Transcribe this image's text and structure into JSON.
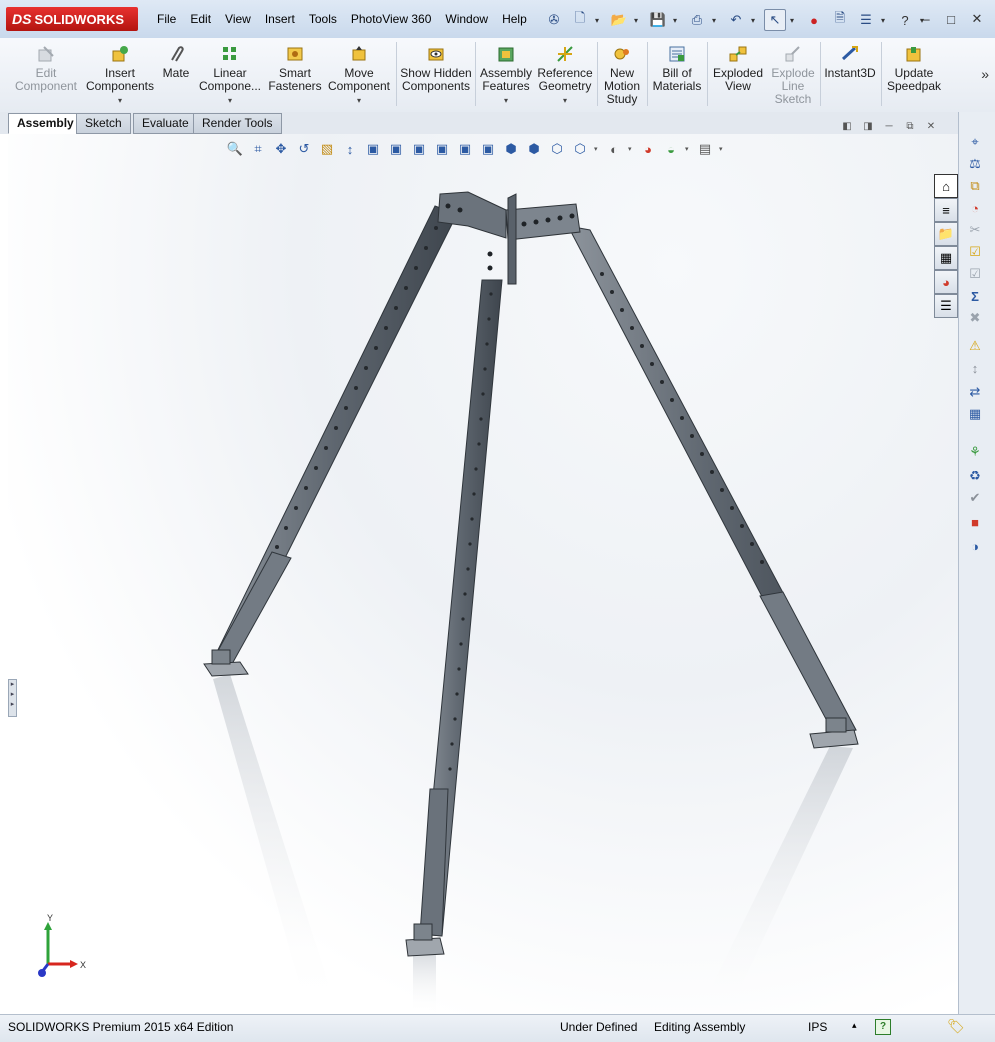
{
  "app": {
    "logo_text": "SOLIDWORKS",
    "logo_mark": "DS"
  },
  "menu": [
    "File",
    "Edit",
    "View",
    "Insert",
    "Tools",
    "PhotoView 360",
    "Window",
    "Help"
  ],
  "ribbon": {
    "edit_component": "Edit Component",
    "insert_components": "Insert Components",
    "mate": "Mate",
    "linear_component": "Linear Compone...",
    "smart_fasteners": "Smart Fasteners",
    "move_component": "Move Component",
    "show_hidden": "Show Hidden Components",
    "assembly_features": "Assembly Features",
    "reference_geometry": "Reference Geometry",
    "new_motion_study": "New Motion Study",
    "bill_of_materials": "Bill of Materials",
    "exploded_view": "Exploded View",
    "explode_line_sketch": "Explode Line Sketch",
    "instant3d": "Instant3D",
    "update_speedpak": "Update Speedpak"
  },
  "tabs": [
    "Assembly",
    "Sketch",
    "Evaluate",
    "Render Tools"
  ],
  "active_tab": "Assembly",
  "triad": {
    "x": "X",
    "y": "Y"
  },
  "status": {
    "edition": "SOLIDWORKS Premium 2015 x64 Edition",
    "definition": "Under Defined",
    "mode": "Editing Assembly",
    "units": "IPS"
  },
  "colors": {
    "brand_red": "#d2211d",
    "accent_blue": "#2c5aa3",
    "steel": "#6f7780"
  }
}
